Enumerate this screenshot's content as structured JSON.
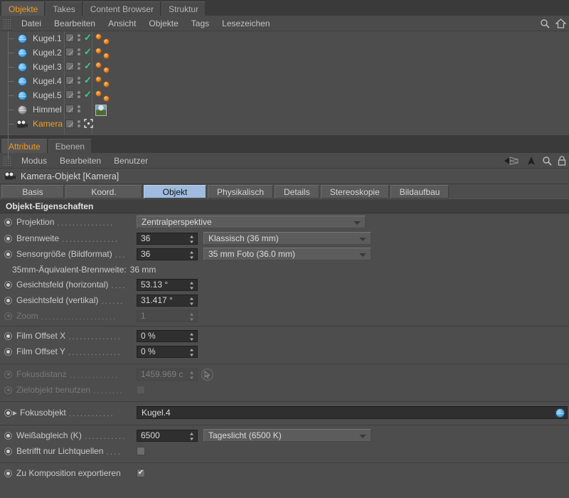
{
  "object_manager": {
    "tabs": [
      {
        "label": "Objekte",
        "active": true
      },
      {
        "label": "Takes",
        "active": false
      },
      {
        "label": "Content Browser",
        "active": false
      },
      {
        "label": "Struktur",
        "active": false
      }
    ],
    "menu": [
      "Datei",
      "Bearbeiten",
      "Ansicht",
      "Objekte",
      "Tags",
      "Lesezeichen"
    ],
    "right_icons": [
      "search-icon",
      "home-icon"
    ],
    "objects": [
      {
        "name": "Kugel.1",
        "icon": "sphere-icon",
        "selected": false,
        "tags": [
          "visibility-tag",
          "render-dots",
          "check-tag"
        ],
        "materials": 2
      },
      {
        "name": "Kugel.2",
        "icon": "sphere-icon",
        "selected": false,
        "tags": [
          "visibility-tag",
          "render-dots",
          "check-tag"
        ],
        "materials": 2
      },
      {
        "name": "Kugel.3",
        "icon": "sphere-icon",
        "selected": false,
        "tags": [
          "visibility-tag",
          "render-dots",
          "check-tag"
        ],
        "materials": 2
      },
      {
        "name": "Kugel.4",
        "icon": "sphere-icon",
        "selected": false,
        "tags": [
          "visibility-tag",
          "render-dots",
          "check-tag"
        ],
        "materials": 2
      },
      {
        "name": "Kugel.5",
        "icon": "sphere-icon",
        "selected": false,
        "tags": [
          "visibility-tag",
          "render-dots",
          "check-tag"
        ],
        "materials": 2
      },
      {
        "name": "Himmel",
        "icon": "sphere-gray-icon",
        "selected": false,
        "tags": [
          "visibility-tag",
          "render-dots"
        ],
        "materials": 0,
        "thumbnail": "sky-material-thumbnail"
      },
      {
        "name": "Kamera",
        "icon": "camera-icon",
        "selected": true,
        "tags": [
          "visibility-tag",
          "render-dots",
          "axis-tag"
        ],
        "materials": 0
      }
    ]
  },
  "attribute_manager": {
    "tabs": [
      {
        "label": "Attribute",
        "active": true
      },
      {
        "label": "Ebenen",
        "active": false
      }
    ],
    "menu": [
      "Modus",
      "Bearbeiten",
      "Benutzer"
    ],
    "toolbar_icons": [
      "back-arrow-icon",
      "up-arrow-icon",
      "search-icon",
      "lock-icon"
    ],
    "header_title": "Kamera-Objekt [Kamera]",
    "header_icon": "camera-icon",
    "prop_tabs": [
      {
        "label": "Basis",
        "active": false
      },
      {
        "label": "Koord.",
        "active": false
      },
      {
        "label": "Objekt",
        "active": true
      },
      {
        "label": "Physikalisch",
        "active": false
      },
      {
        "label": "Details",
        "active": false
      },
      {
        "label": "Stereoskopie",
        "active": false
      },
      {
        "label": "Bildaufbau",
        "active": false
      }
    ],
    "group_title": "Objekt-Eigenschaften",
    "rows": {
      "projektion": {
        "label": "Projektion",
        "value": "Zentralperspektive"
      },
      "brennweite": {
        "label": "Brennweite",
        "value": "36",
        "preset": "Klassisch (36 mm)"
      },
      "sensorgroesse": {
        "label": "Sensorgröße (Bildformat)",
        "value": "36",
        "preset": "35 mm Foto (36.0 mm)"
      },
      "aequivalent": {
        "label": "35mm-Äquivalent-Brennweite:",
        "value": "36 mm"
      },
      "fov_h": {
        "label": "Gesichtsfeld (horizontal)",
        "value": "53.13 °"
      },
      "fov_v": {
        "label": "Gesichtsfeld (vertikal)",
        "value": "31.417 °"
      },
      "zoom": {
        "label": "Zoom",
        "value": "1",
        "disabled": true
      },
      "film_offset_x": {
        "label": "Film Offset X",
        "value": "0 %"
      },
      "film_offset_y": {
        "label": "Film Offset Y",
        "value": "0 %"
      },
      "fokusdistanz": {
        "label": "Fokusdistanz",
        "value": "1459.969 c",
        "disabled": true,
        "picker": "picker-icon"
      },
      "zielobjekt": {
        "label": "Zielobjekt benutzen",
        "checked": false,
        "disabled": true
      },
      "fokusobjekt": {
        "label": "Fokusobjekt",
        "value": "Kugel.4"
      },
      "weissabgleich": {
        "label": "Weißabgleich (K)",
        "value": "6500",
        "preset": "Tageslicht (6500 K)"
      },
      "betrifft_licht": {
        "label": "Betrifft nur Lichtquellen",
        "checked": false
      },
      "komposition": {
        "label": "Zu Komposition exportieren",
        "checked": true
      }
    }
  },
  "colors": {
    "accent": "#f0a11e",
    "tab_active": "#9fbbdf",
    "panel_bg": "#4d4d4d",
    "field_bg": "#2f2f2f"
  }
}
